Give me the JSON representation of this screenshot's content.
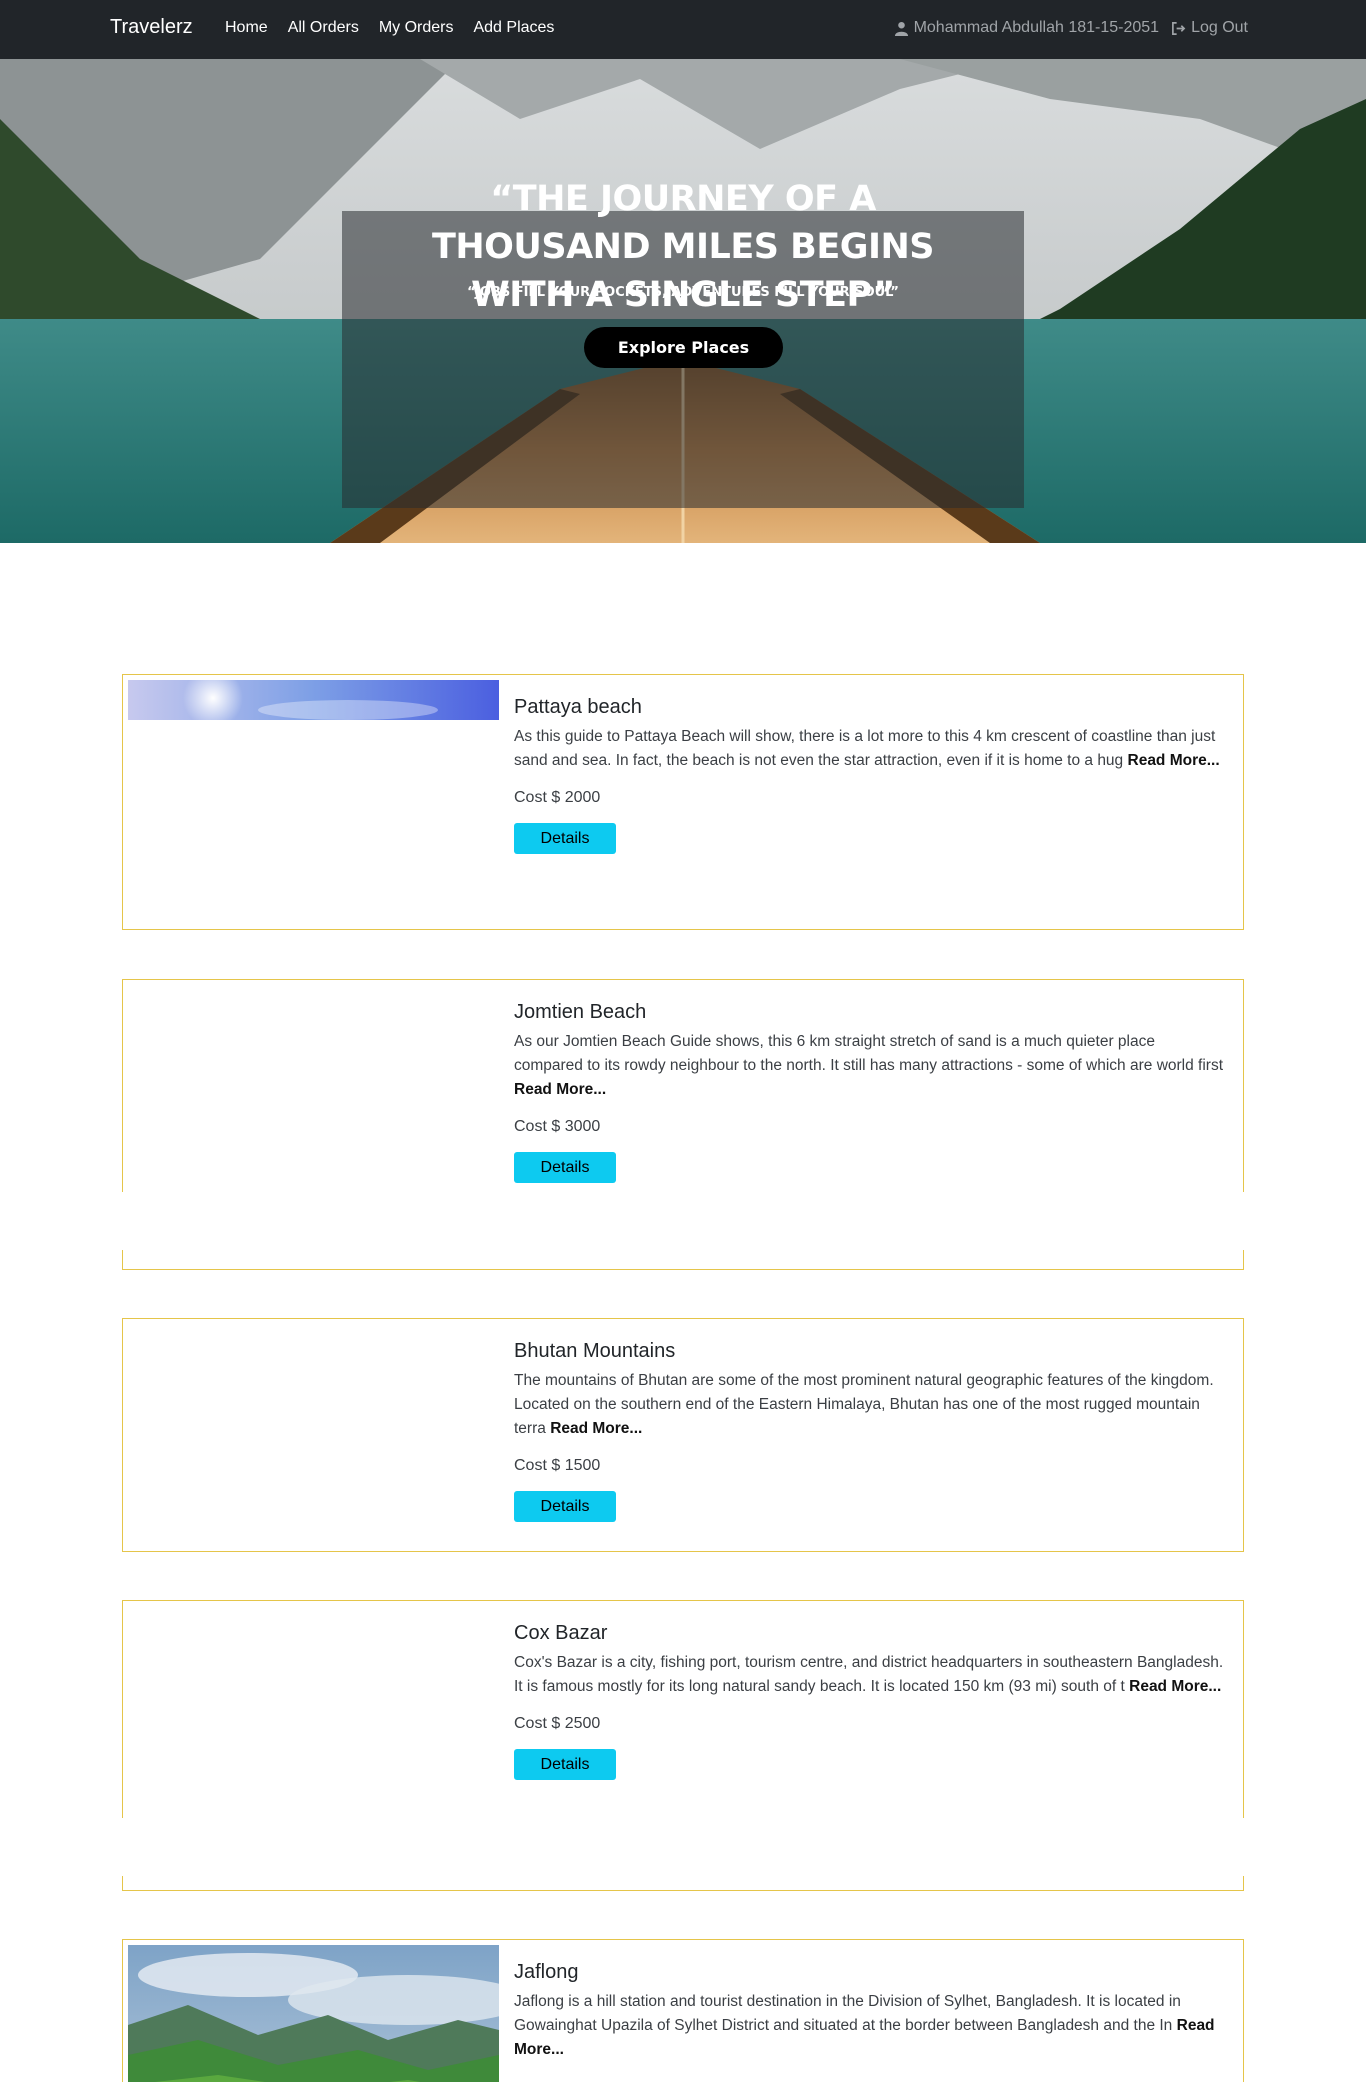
{
  "navbar": {
    "brand": "Travelerz",
    "links": [
      "Home",
      "All Orders",
      "My Orders",
      "Add Places"
    ],
    "user_name": "Mohammad Abdullah 181-15-2051",
    "logout_label": "Log Out",
    "user_icon": "user-icon",
    "logout_icon": "sign-out-icon"
  },
  "hero": {
    "quote": "“THE JOURNEY OF A THOUSAND MILES BEGINS WITH A SINGLE STEP”",
    "subtitle": "“JOBS FILL YOUR POCKETS, ADVENTURES FILL YOUR SOUL”",
    "button_label": "Explore Places"
  },
  "places": [
    {
      "title": "Pattaya beach",
      "description": "As this guide to Pattaya Beach will show, there is a lot more to this 4 km crescent of coastline than just sand and sea. In fact, the beach is not even the star attraction, even if it is home to a hug",
      "read_more": "Read More...",
      "cost": "Cost $ 2000",
      "button_label": "Details"
    },
    {
      "title": "Jomtien Beach",
      "description": "As our Jomtien Beach Guide shows, this 6 km straight stretch of sand is a much quieter place compared to its rowdy neighbour to the north. It still has many attractions - some of which are world first",
      "read_more": "Read More...",
      "cost": "Cost $ 3000",
      "button_label": "Details"
    },
    {
      "title": "Bhutan Mountains",
      "description": "The mountains of Bhutan are some of the most prominent natural geographic features of the kingdom. Located on the southern end of the Eastern Himalaya, Bhutan has one of the most rugged mountain terra",
      "read_more": "Read More...",
      "cost": "Cost $ 1500",
      "button_label": "Details"
    },
    {
      "title": "Cox Bazar",
      "description": "Cox's Bazar is a city, fishing port, tourism centre, and district headquarters in southeastern Bangladesh. It is famous mostly for its long natural sandy beach. It is located 150 km (93 mi) south of t",
      "read_more": "Read More...",
      "cost": "Cost $ 2500",
      "button_label": "Details"
    },
    {
      "title": "Jaflong",
      "description": "Jaflong is a hill station and tourist destination in the Division of Sylhet, Bangladesh. It is located in Gowainghat Upazila of Sylhet District and situated at the border between Bangladesh and the In",
      "read_more": "Read More..."
    }
  ],
  "colors": {
    "navbar_bg": "#212529",
    "card_border": "#e5c54a",
    "details_button": "#0dcaf0",
    "hero_button": "#000000"
  }
}
